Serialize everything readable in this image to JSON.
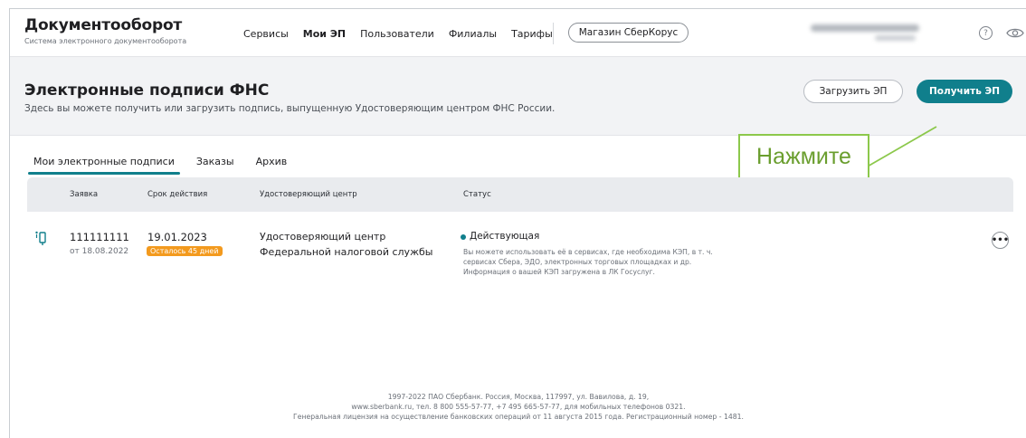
{
  "app": {
    "title": "Документооборот",
    "subtitle": "Система электронного документооборота"
  },
  "nav": {
    "items": [
      {
        "label": "Сервисы",
        "active": false
      },
      {
        "label": "Мои ЭП",
        "active": true
      },
      {
        "label": "Пользователи",
        "active": false
      },
      {
        "label": "Филиалы",
        "active": false
      },
      {
        "label": "Тарифы",
        "active": false
      }
    ],
    "shop_label": "Магазин СберКорус",
    "help_icon": "question-circle-icon",
    "view_icon": "eye-icon"
  },
  "header": {
    "title": "Электронные подписи ФНС",
    "subtitle": "Здесь вы можете получить или загрузить подпись, выпущенную Удостоверяющим центром ФНС России.",
    "upload_label": "Загрузить ЭП",
    "get_label": "Получить ЭП"
  },
  "annotation": {
    "text": "Нажмите"
  },
  "tabs": [
    {
      "label": "Мои электронные подписи",
      "active": true
    },
    {
      "label": "Заказы",
      "active": false
    },
    {
      "label": "Архив",
      "active": false
    }
  ],
  "table": {
    "columns": [
      "Заявка",
      "Срок действия",
      "Удостоверяющий центр",
      "Статус"
    ],
    "rows": [
      {
        "icon": "usb-token-icon",
        "app_number": "111111111",
        "app_date": "от 18.08.2022",
        "expiry": "19.01.2023",
        "remaining": "Осталось 45 дней",
        "ca_line1": "Удостоверяющий центр",
        "ca_line2": "Федеральной налоговой службы",
        "status": "Действующая",
        "status_desc": [
          "Вы можете использовать её в сервисах, где необходима КЭП, в т. ч.",
          "сервисах Сбера, ЭДО, электронных торговых площадках и др.",
          "Информация о вашей КЭП загружена в ЛК Госуслуг."
        ],
        "more": "•••"
      }
    ]
  },
  "footer": {
    "lines": [
      "1997-2022 ПАО Сбербанк. Россия, Москва, 117997, ул. Вавилова, д. 19,",
      "www.sberbank.ru, тел. 8 800 555-57-77, +7 495 665-57-77, для мобильных телефонов 0321.",
      "Генеральная лицензия на осуществление банковских операций от 11 августа 2015 года. Регистрационный номер - 1481."
    ]
  },
  "colors": {
    "accent": "#107f8c",
    "warning": "#f39a1e",
    "annotation": "#8cc84b"
  }
}
